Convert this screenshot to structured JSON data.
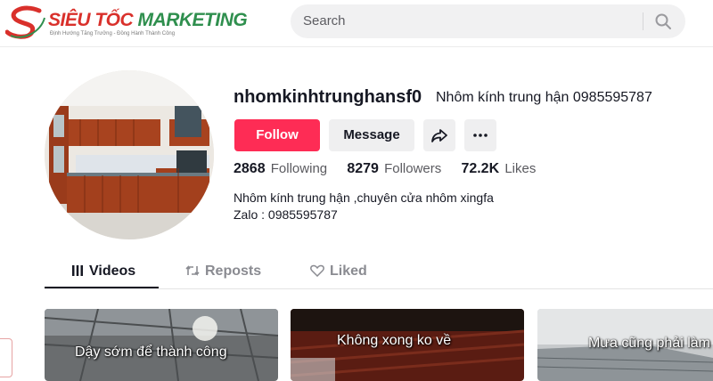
{
  "header": {
    "logo": {
      "title_part1": "SIÊU TỐC",
      "title_part2": "MARKETING",
      "tagline": "Định Hướng Tăng Trưởng - Đồng Hành Thành Công",
      "icon": "s-logo-icon"
    },
    "search": {
      "placeholder": "Search",
      "icon": "search-icon"
    }
  },
  "profile": {
    "username": "nhomkinhtrunghansf0",
    "display_name": "Nhôm kính trung hận 0985595787",
    "buttons": {
      "follow": "Follow",
      "message": "Message",
      "share_icon": "share-icon",
      "more_icon": "more-icon"
    },
    "stats": [
      {
        "value": "2868",
        "label": "Following"
      },
      {
        "value": "8279",
        "label": "Followers"
      },
      {
        "value": "72.2K",
        "label": "Likes"
      }
    ],
    "bio": [
      "Nhôm kính trung hận ,chuyên cửa nhôm xingfa",
      "Zalo : 0985595787"
    ]
  },
  "tabs": [
    {
      "label": "Videos",
      "icon": "grid-icon",
      "active": true
    },
    {
      "label": "Reposts",
      "icon": "repost-icon",
      "active": false
    },
    {
      "label": "Liked",
      "icon": "heart-icon",
      "active": false
    }
  ],
  "videos": [
    {
      "caption": "Dậy sớm để thành công"
    },
    {
      "caption": "Không xong ko về"
    },
    {
      "caption": "Mưa cũng  phải làm"
    }
  ],
  "colors": {
    "accent": "#fe2c55",
    "text": "#161823",
    "secondary_btn": "#efeff0"
  }
}
